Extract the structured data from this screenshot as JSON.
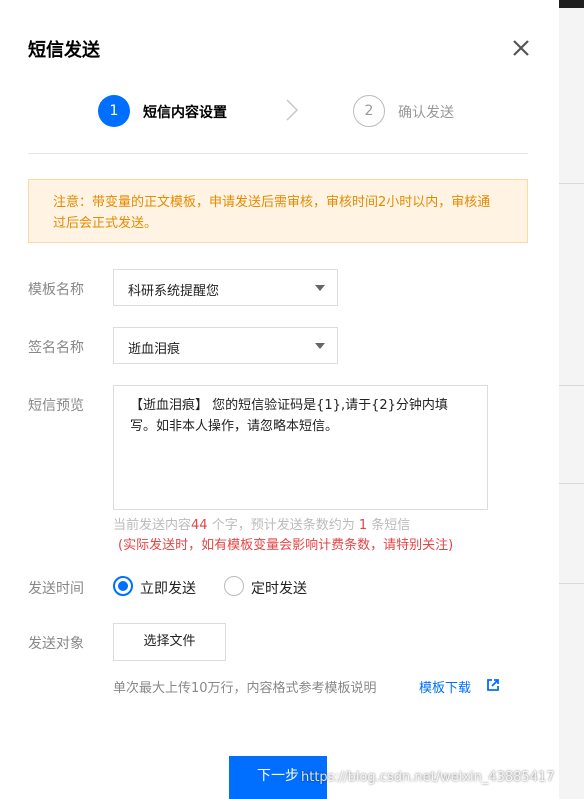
{
  "dialog": {
    "title": "短信发送",
    "close_icon": "close-icon"
  },
  "steps": [
    {
      "number": "1",
      "label": "短信内容设置",
      "state": "active"
    },
    {
      "number": "2",
      "label": "确认发送",
      "state": "inactive"
    }
  ],
  "notice": {
    "text": "注意：带变量的正文模板，申请发送后需审核，审核时间2小时以内，审核通过后会正式发送。"
  },
  "form": {
    "template": {
      "label": "模板名称",
      "value": "科研系统提醒您"
    },
    "signature": {
      "label": "签名名称",
      "value": "逝血泪痕"
    },
    "preview": {
      "label": "短信预览",
      "content": "【逝血泪痕】 您的短信验证码是{1},请于{2}分钟内填写。如非本人操作，请忽略本短信。"
    },
    "hint": {
      "prefix": "当前发送内容",
      "char_count": "44",
      "middle": " 个字，预计发送条数约为 ",
      "msg_count": "1",
      "suffix": " 条短信",
      "warning": "(实际发送时，如有模板变量会影响计费条数，请特别关注)"
    },
    "send_time": {
      "label": "发送时间",
      "options": [
        {
          "label": "立即发送",
          "selected": true
        },
        {
          "label": "定时发送",
          "selected": false
        }
      ]
    },
    "send_target": {
      "label": "发送对象",
      "button": "选择文件",
      "note": "单次最大上传10万行，内容格式参考模板说明",
      "link": "模板下载",
      "link_icon": "external-link-icon"
    }
  },
  "footer": {
    "next_button": "下一步"
  },
  "watermark": "https://blog.csdn.net/weixin_43885417",
  "colors": {
    "primary": "#006eff",
    "notice_text": "#e58a00",
    "notice_bg": "#fff4e3",
    "warning": "#e54545"
  }
}
